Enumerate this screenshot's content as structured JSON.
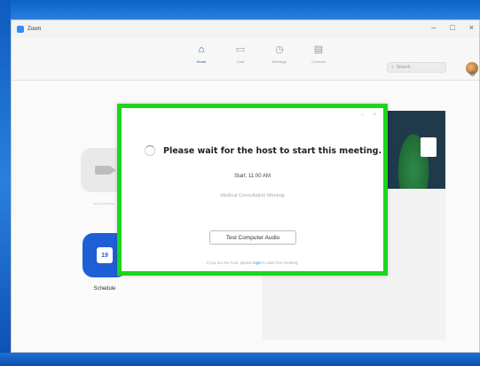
{
  "window": {
    "title": "Zoom",
    "controls": [
      "–",
      "□",
      "×"
    ]
  },
  "nav": {
    "items": [
      {
        "label": "Home",
        "icon": "home-icon",
        "glyph": "⌂",
        "active": true
      },
      {
        "label": "Chat",
        "icon": "chat-icon",
        "glyph": "▭",
        "active": false
      },
      {
        "label": "Meetings",
        "icon": "clock-icon",
        "glyph": "◷",
        "active": false
      },
      {
        "label": "Contacts",
        "icon": "contacts-icon",
        "glyph": "▤",
        "active": false
      }
    ]
  },
  "search": {
    "icon": "search-icon",
    "placeholder": "Search"
  },
  "home": {
    "tiles": [
      {
        "label": "New Meeting",
        "icon": "video-camera-icon",
        "color": "#e9e9e9"
      },
      {
        "label": "Schedule",
        "icon": "calendar-icon",
        "day": "19",
        "color": "#1f5fd6"
      }
    ]
  },
  "modal": {
    "border_color": "#1cd61c",
    "controls": [
      "–",
      "×"
    ],
    "title": "Please wait for the host to start this meeting.",
    "start_time": "Start: 11:00 AM",
    "meeting_name": "Medical Consultation Meeting",
    "test_audio_label": "Test Computer Audio",
    "host_note_prefix": "If you are the host, please ",
    "host_note_link": "login",
    "host_note_suffix": " to start this meeting."
  },
  "colors": {
    "desktop_blue": "#1e6fd4",
    "accent": "#2d8cff",
    "active_nav": "#1f4d8c"
  }
}
